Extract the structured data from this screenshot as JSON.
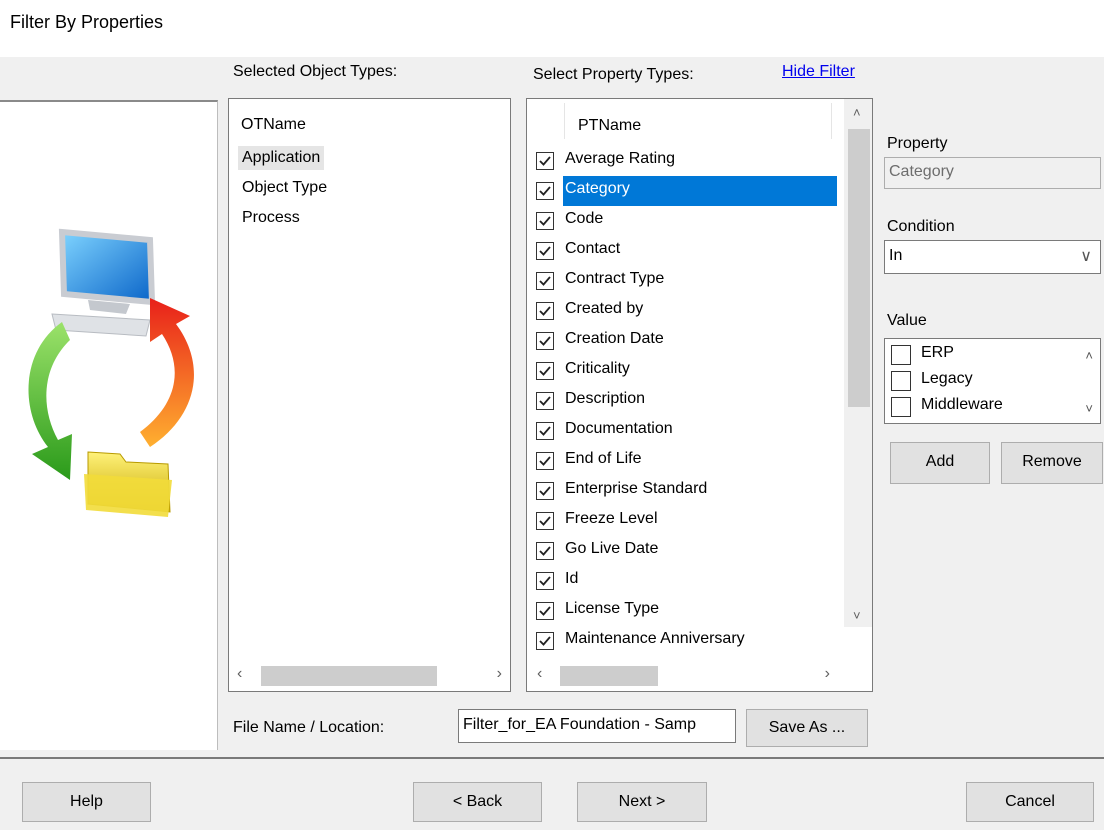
{
  "window": {
    "title": "Filter By Properties"
  },
  "object_types": {
    "heading": "Selected Object Types:",
    "column_header": "OTName",
    "items": [
      "Application",
      "Object Type",
      "Process"
    ]
  },
  "property_types": {
    "heading": "Select Property Types:",
    "hide_filter_link": "Hide Filter",
    "column_header": "PTName",
    "items": [
      {
        "label": "Average Rating",
        "checked": true
      },
      {
        "label": "Category",
        "checked": true,
        "selected": true
      },
      {
        "label": "Code",
        "checked": true
      },
      {
        "label": "Contact",
        "checked": true
      },
      {
        "label": "Contract Type",
        "checked": true
      },
      {
        "label": "Created by",
        "checked": true
      },
      {
        "label": "Creation Date",
        "checked": true
      },
      {
        "label": "Criticality",
        "checked": true
      },
      {
        "label": "Description",
        "checked": true
      },
      {
        "label": "Documentation",
        "checked": true
      },
      {
        "label": "End of Life",
        "checked": true
      },
      {
        "label": "Enterprise Standard",
        "checked": true
      },
      {
        "label": "Freeze Level",
        "checked": true
      },
      {
        "label": "Go Live Date",
        "checked": true
      },
      {
        "label": "Id",
        "checked": true
      },
      {
        "label": "License Type",
        "checked": true
      },
      {
        "label": "Maintenance Anniversary",
        "checked": true
      }
    ]
  },
  "filter": {
    "property_label": "Property",
    "property_value": "Category",
    "condition_label": "Condition",
    "condition_value": "In",
    "value_label": "Value",
    "values": [
      {
        "label": "ERP",
        "checked": false
      },
      {
        "label": "Legacy",
        "checked": false
      },
      {
        "label": "Middleware",
        "checked": false
      }
    ],
    "add_button": "Add",
    "remove_button": "Remove"
  },
  "file": {
    "label": "File Name / Location:",
    "value": "Filter_for_EA Foundation - Samp",
    "save_as_button": "Save As ..."
  },
  "footer": {
    "help_button": "Help",
    "back_button": "< Back",
    "next_button": "Next >",
    "cancel_button": "Cancel"
  }
}
